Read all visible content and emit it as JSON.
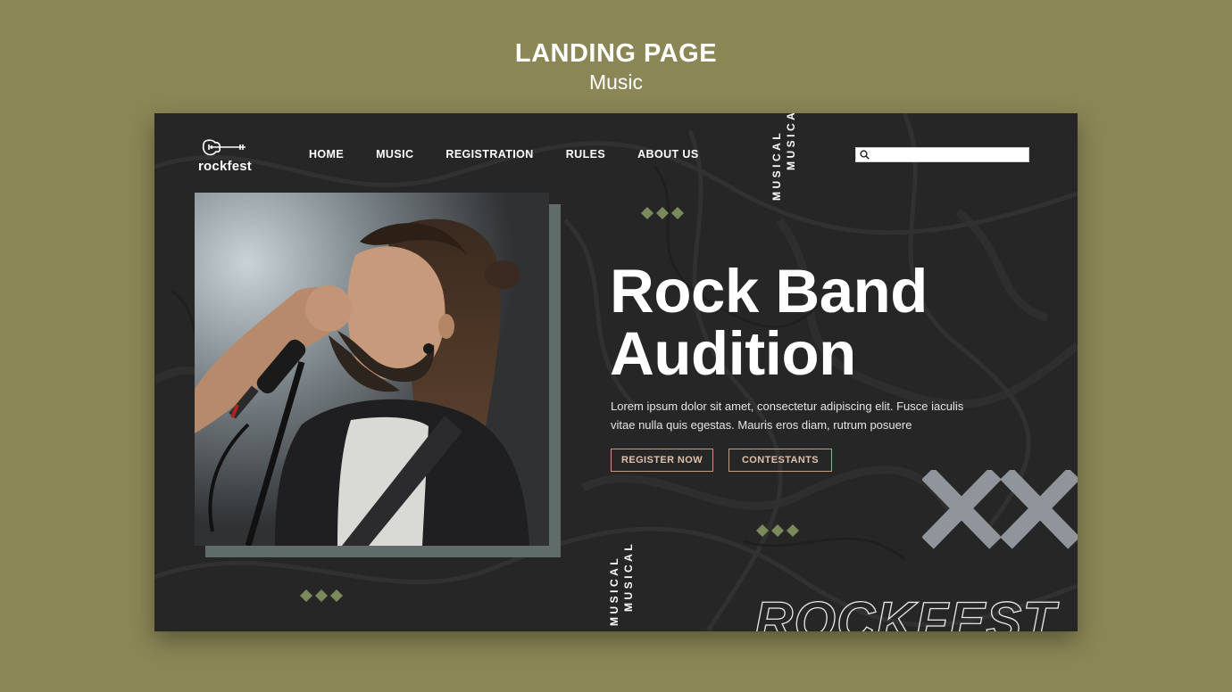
{
  "heading": {
    "title": "LANDING PAGE",
    "subtitle": "Music"
  },
  "site": {
    "logo_text": "rockfest",
    "nav": [
      {
        "label": "HOME"
      },
      {
        "label": "MUSIC"
      },
      {
        "label": "REGISTRATION"
      },
      {
        "label": "RULES"
      },
      {
        "label": "ABOUT US"
      }
    ],
    "vertical_text_top": [
      "MUSICAL",
      "MUSICAL"
    ],
    "search": {
      "value": "",
      "placeholder": ""
    },
    "hero": {
      "title_line1": "Rock Band",
      "title_line2": "Audition",
      "description": "Lorem ipsum dolor sit amet, consectetur adipiscing elit. Fusce iaculis vitae nulla quis egestas. Mauris eros diam, rutrum posuere",
      "btn_register": "REGISTER NOW",
      "btn_contestants": "CONTESTANTS"
    },
    "vertical_text_bottom": [
      "MUSICAL",
      "MUSICAL"
    ],
    "footer_word": "ROCKFEST"
  },
  "colors": {
    "background": "#8b8656",
    "panel": "#262626",
    "accent_green": "#7a8a5c",
    "button_border": "#c59a81",
    "cross": "#8f959a"
  },
  "icons": [
    "guitar-logo-icon",
    "search-icon",
    "diamond-icon",
    "cross-icon"
  ]
}
